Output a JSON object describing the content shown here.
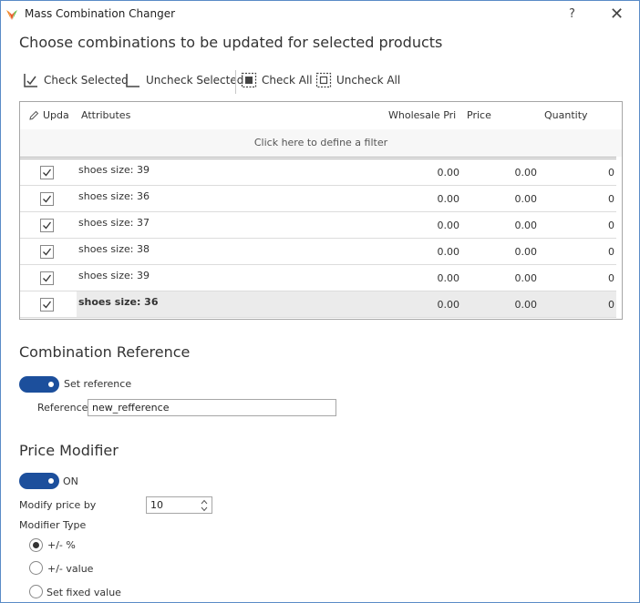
{
  "window": {
    "title": "Mass Combination Changer",
    "help_label": "?",
    "close_label": "✕"
  },
  "header": {
    "heading": "Choose combinations to be updated for selected products"
  },
  "toolbar": {
    "check_selected": "Check Selected",
    "uncheck_selected": "Uncheck Selected",
    "check_all": "Check All",
    "uncheck_all": "Uncheck All"
  },
  "grid": {
    "columns": {
      "update": "Upda",
      "attributes": "Attributes",
      "wholesale_price": "Wholesale Pric",
      "price": "Price",
      "quantity": "Quantity"
    },
    "filter_text": "Click here to define a filter",
    "rows": [
      {
        "checked": true,
        "attributes": "shoes size: 39",
        "wholesale": "0.00",
        "price": "0.00",
        "quantity": "0"
      },
      {
        "checked": true,
        "attributes": "shoes size: 36",
        "wholesale": "0.00",
        "price": "0.00",
        "quantity": "0"
      },
      {
        "checked": true,
        "attributes": "shoes size: 37",
        "wholesale": "0.00",
        "price": "0.00",
        "quantity": "0"
      },
      {
        "checked": true,
        "attributes": "shoes size: 38",
        "wholesale": "0.00",
        "price": "0.00",
        "quantity": "0"
      },
      {
        "checked": true,
        "attributes": "shoes size: 39",
        "wholesale": "0.00",
        "price": "0.00",
        "quantity": "0"
      },
      {
        "checked": true,
        "attributes": "shoes size: 36",
        "wholesale": "0.00",
        "price": "0.00",
        "quantity": "0"
      }
    ]
  },
  "combination_reference": {
    "heading": "Combination Reference",
    "toggle_label": "Set reference",
    "toggle_on": true,
    "reference_label": "Reference",
    "reference_value": "new_refference"
  },
  "price_modifier": {
    "heading": "Price Modifier",
    "toggle_label": "ON",
    "toggle_on": true,
    "modify_label": "Modify price by",
    "modify_value": "10",
    "modifier_type_label": "Modifier Type",
    "options": [
      {
        "label": "+/- %",
        "selected": true
      },
      {
        "label": "+/- value",
        "selected": false
      },
      {
        "label": "Set fixed value",
        "selected": false
      }
    ]
  },
  "colors": {
    "accent": "#1c4f9c",
    "window_border": "#5a8bc7"
  }
}
